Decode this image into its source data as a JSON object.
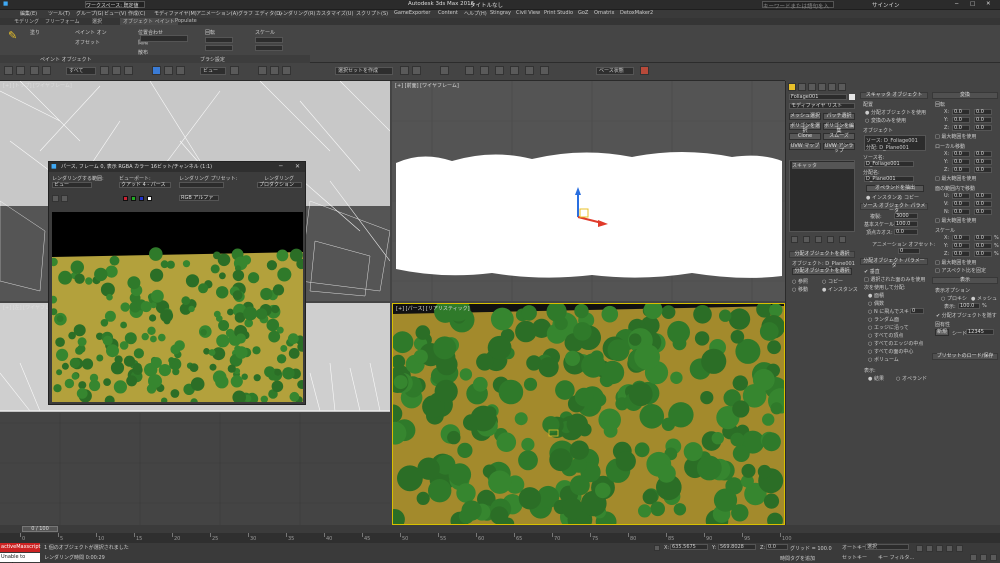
{
  "titlebar": {
    "workspace": "ワークスペース: 既定値",
    "app_title": "Autodesk 3ds Max 2016",
    "doc_title": "タイトルなし",
    "search_placeholder": "キーワードまたは語句を入力",
    "user": "サインイン"
  },
  "menu": [
    "編集(E)",
    "ツール(T)",
    "グループ(G)",
    "ビュー(V)",
    "作成(C)",
    "モディファイヤ(M)",
    "アニメーション(A)",
    "グラフ エディタ(D)",
    "レンダリング(R)",
    "カスタマイズ(U)",
    "スクリプト(S)",
    "GameExporter",
    "Content",
    "ヘルプ(H)",
    "Stingray",
    "Civil View",
    "Print Studio",
    "GoZ",
    "Ornatrix",
    "DetoxMaker2"
  ],
  "ribbon_tabs": [
    "モデリング",
    "フリーフォーム",
    "選択",
    "オブジェクト ペイント",
    "Populate"
  ],
  "ribbon": {
    "paint_objects_label": "ペイント オブジェクト",
    "brush_settings_label": "ブラシ設定",
    "fill_label": "塗り",
    "paint_on_label": "ペイント オン",
    "offset_label": "オフセット",
    "align_label": "位置合わせ",
    "spacing_label": "間隔",
    "scatter_label": "散布",
    "rotate_label": "回転",
    "scale_label": "スケール"
  },
  "toolbar": {
    "selection_filter": "すべて",
    "view_dropdown": "ビュー",
    "selection_set": "選択セットを作成",
    "named_state": "ベース状態"
  },
  "viewports": {
    "top_label": "[+] [トップ] [ワイヤフレーム]",
    "front_label": "[+] [前面] [ワイヤフレーム]",
    "left_label": "[+] [左] [ワイヤフレーム]",
    "persp_label": "[+] [パース] [リアリスティック]"
  },
  "render_window": {
    "title": "パース, フレーム 0, 表示 RGBA カラー 16ビット/チャンネル (1:1)",
    "area_label": "レンダリングする範囲:",
    "area_value": "ビュー",
    "viewport_label": "ビューポート:",
    "viewport_value": "クアッド 4 - パース",
    "preset_label": "レンダリング プリセット:",
    "render_label": "レンダリング",
    "production_value": "プロダクション",
    "channel_value": "RGB アルファ"
  },
  "command_panel": {
    "object_name": "Foliage001",
    "modifier_list": "モディファイヤ リスト",
    "buttons": [
      "メッシュ選択",
      "パッチ選択",
      "ポリゴンを選択",
      "ポリゴンを編集",
      "Clone",
      "スムーズ",
      "UVW マップ",
      "UVW アンラップ"
    ],
    "stack_item": "スキャッタ",
    "scatter_header": "スキャッタ オブジェクト",
    "distribution_label": "配置",
    "use_distribution_object": "分配オブジェクトを使用",
    "use_transform_only": "変換のみを使用",
    "objects_label": "オブジェクト",
    "source_name": "ソース: D_Foliage001",
    "dist_name": "分配: D_Plane001",
    "source_name_label": "ソース名:",
    "source_name_value": "D_Foliage001",
    "dist_name_label": "分配名:",
    "dist_name_value": "D_Plane001",
    "extract_operand": "オペランドを抽出",
    "instance": "インスタンス",
    "copy": "コピー",
    "source_params": "ソース オブジェクト パラメータ",
    "duplicates_label": "複製:",
    "duplicates_value": "3000",
    "base_scale_label": "基本スケール:",
    "base_scale_value": "100.0",
    "vertex_chaos_label": "頂点カオス:",
    "vertex_chaos_value": "0.0",
    "anim_offset_label": "アニメーション オフセット:",
    "anim_offset_value": "0",
    "pick_dist_header": "分配オブジェクトを選択",
    "dist_object_label": "オブジェクト: D_Plane001",
    "pick_dist_button": "分配オブジェクトを選択",
    "reference": "参照",
    "move": "移動",
    "dist_params": "分配オブジェクト パラメータ",
    "perpendicular": "垂直",
    "use_selected_faces": "選択された面のみを使用",
    "distribute_using": "次を使用して分配:",
    "dist_options": [
      "面積",
      "偶数",
      "N に飛んでスキップ",
      "ランダム面",
      "エッジに沿って",
      "すべての頂点",
      "すべてのエッジの中点",
      "すべての面の中心",
      "ボリューム"
    ],
    "skip_value": "0",
    "display_label": "表示:",
    "result": "結果",
    "operand": "オペランド",
    "transforms_header": "変換",
    "rotation_label": "回転",
    "local_translation_label": "ローカル移動",
    "on_surface_label": "面の範囲内で移動",
    "scaling_label": "スケール",
    "use_max_range": "最大範囲を使用",
    "lock_aspect": "アスペクト比を固定",
    "xyz": [
      "X:",
      "Y:",
      "Z:"
    ],
    "uv": [
      "U:",
      "V:",
      "N:"
    ],
    "zero_value": "0.0",
    "scale_pct": "0.0",
    "display_header": "表示",
    "display_options": "表示オプション",
    "proxies": "プロキシ",
    "mesh": "メッシュ",
    "display_pct_label": "表示:",
    "display_pct_value": "100.0",
    "hide_dist": "分配オブジェクトを隠す",
    "uniqueness_label": "固有性",
    "new": "新規",
    "seed_label": "シード:",
    "seed_value": "12345",
    "load_preset": "プリセットのロード/保存"
  },
  "timeline": {
    "frame_counter": "0 / 100",
    "ticks": [
      "0",
      "5",
      "10",
      "15",
      "20",
      "25",
      "30",
      "35",
      "40",
      "45",
      "50",
      "55",
      "60",
      "65",
      "70",
      "75",
      "80",
      "85",
      "90",
      "95",
      "100"
    ]
  },
  "status": {
    "maxscript_label": "activeMaxscript",
    "unable": "Unable to create",
    "selected_msg": "1 個のオブジェクトが選択されました",
    "render_time": "レンダリング時間 0:00:29",
    "x_label": "X:",
    "x_value": "635.5675",
    "y_label": "Y:",
    "y_value": "569.8028",
    "z_label": "Z:",
    "z_value": "0.0",
    "grid": "グリッド = 100.0",
    "add_time_tag": "時間タグを追加",
    "auto_key": "オートキー",
    "selected_dd": "選択",
    "set_key": "セットキー",
    "key_filter": "キー フィルタ..."
  }
}
